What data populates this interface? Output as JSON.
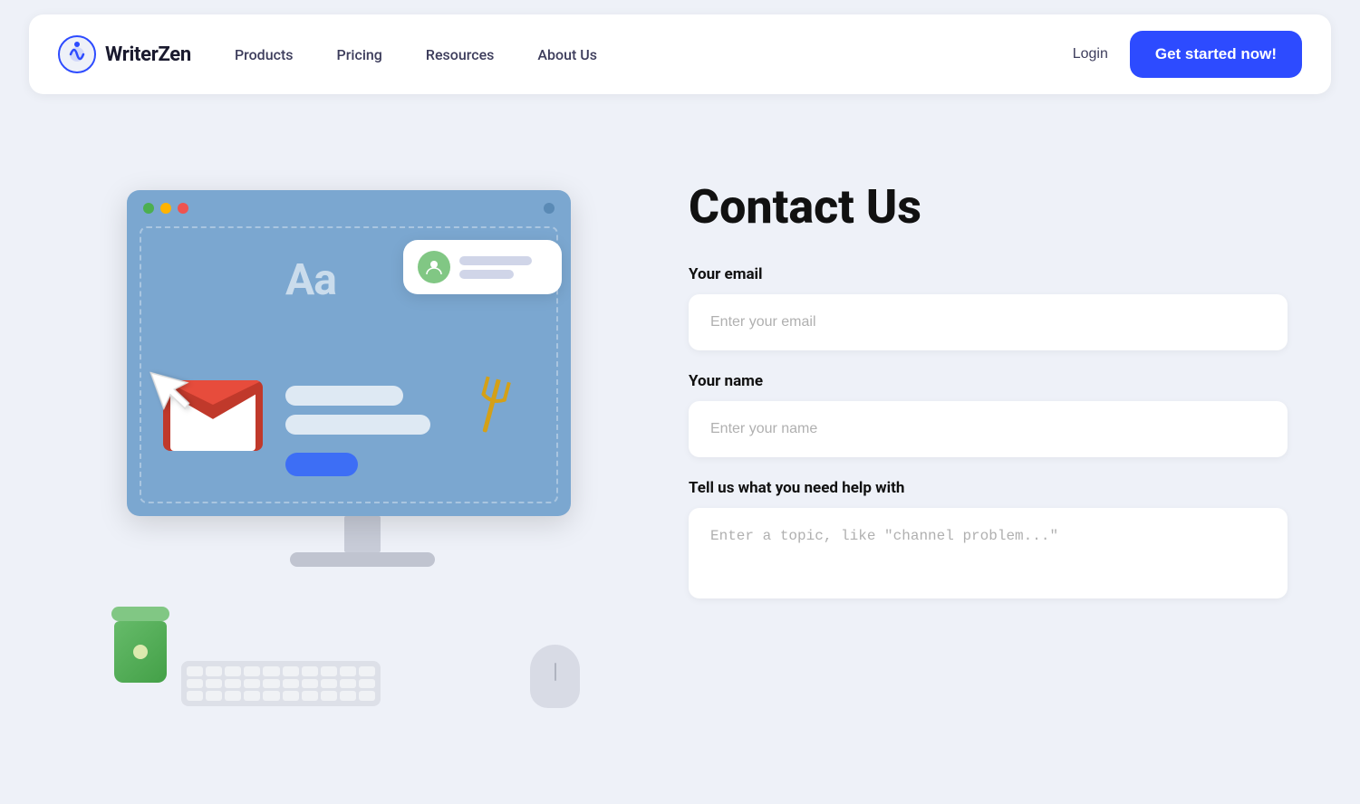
{
  "navbar": {
    "logo_text": "WriterZen",
    "nav_links": [
      {
        "id": "products",
        "label": "Products"
      },
      {
        "id": "pricing",
        "label": "Pricing"
      },
      {
        "id": "resources",
        "label": "Resources"
      },
      {
        "id": "about",
        "label": "About Us"
      }
    ],
    "login_label": "Login",
    "cta_label": "Get started now!"
  },
  "contact_form": {
    "title": "Contact Us",
    "email_label": "Your email",
    "email_placeholder": "Enter your email",
    "name_label": "Your name",
    "name_placeholder": "Enter your name",
    "help_label": "Tell us what you need help with",
    "help_placeholder": "Enter a topic, like \"channel problem...\""
  }
}
